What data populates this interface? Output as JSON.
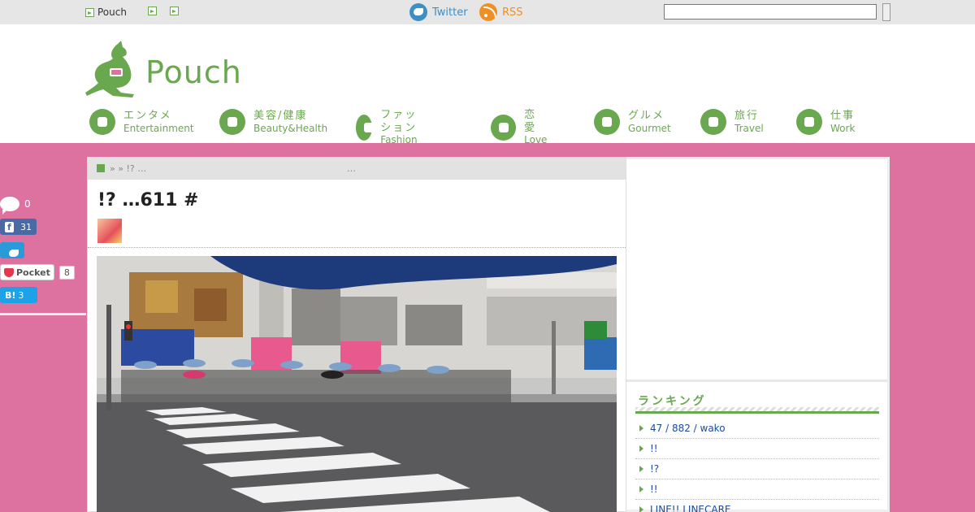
{
  "topbar": {
    "links": [
      "Pouch",
      "",
      ""
    ],
    "twitter": "Twitter",
    "rss": "RSS",
    "search_placeholder": ""
  },
  "header": {
    "logo_text": "Pouch",
    "nav": [
      {
        "jp": "エンタメ",
        "en": "Entertainment"
      },
      {
        "jp": "美容/健康",
        "en": "Beauty&Health"
      },
      {
        "jp": "ファッション",
        "en": "Fashion"
      },
      {
        "jp": "恋愛",
        "en": "Love"
      },
      {
        "jp": "グルメ",
        "en": "Gourmet"
      },
      {
        "jp": "旅行",
        "en": "Travel"
      },
      {
        "jp": "仕事",
        "en": "Work"
      }
    ]
  },
  "share": {
    "comments": "0",
    "facebook_label": "f",
    "facebook_count": "31",
    "twitter_label": "",
    "pocket_label": "Pocket",
    "pocket_count": "8",
    "hatena_label": "B!",
    "hatena_count": "3"
  },
  "article": {
    "breadcrumb": "» » !? …",
    "breadcrumb_right": "…",
    "title": "!? …611 #"
  },
  "sidebar": {
    "section_title": "ランキング",
    "items": [
      "47 /  882 / wako",
      "!!",
      "!?",
      "!!",
      "LINE!! LINECARE"
    ]
  },
  "colors": {
    "accent": "#6aa84f",
    "background": "#dd72a1",
    "link": "#1a4a9e"
  }
}
